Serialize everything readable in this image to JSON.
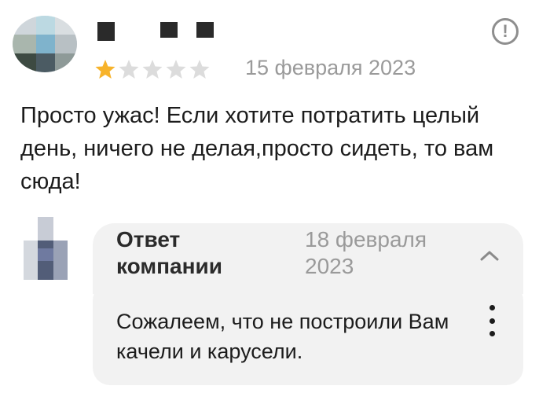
{
  "review": {
    "rating": 1,
    "rating_max": 5,
    "date": "15 февраля 2023",
    "text": "Просто ужас! Если хотите потратить целый день, ничего не делая,просто сидеть, то вам сюда!"
  },
  "reply": {
    "title": "Ответ компании",
    "date": "18 февраля 2023",
    "text": "Сожалеем, что не построили Вам качели и карусели."
  },
  "colors": {
    "star_filled": "#f7b32b",
    "star_empty": "#dcdcdc",
    "muted_text": "#9a9a9a",
    "bubble_bg": "#f2f2f2"
  }
}
